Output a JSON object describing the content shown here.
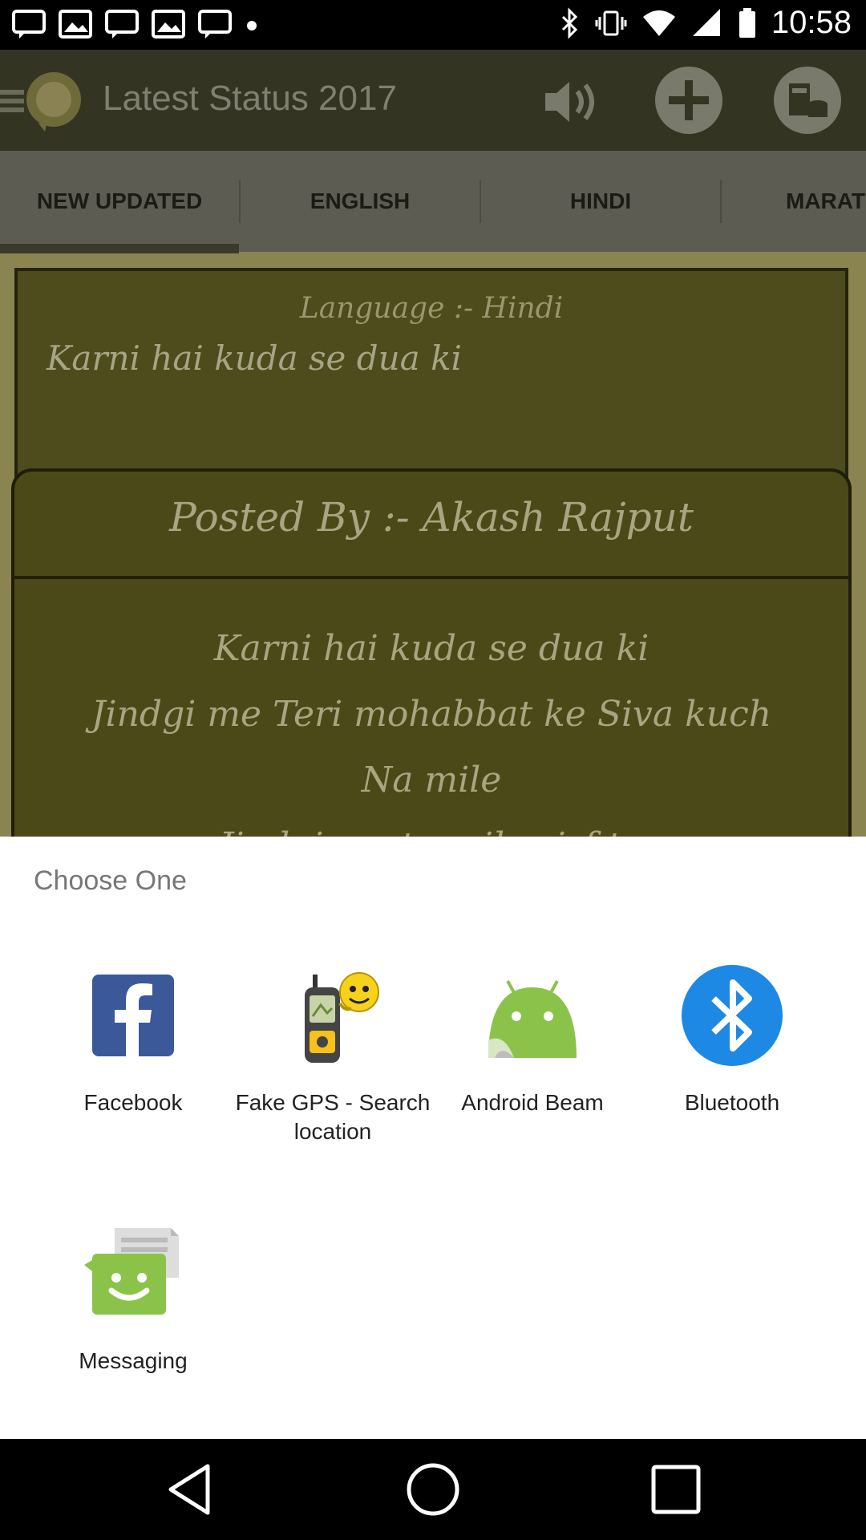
{
  "status_bar": {
    "time": "10:58",
    "left_icons": [
      "message-icon",
      "gallery-icon",
      "message-icon",
      "gallery-icon",
      "message-icon",
      "notification-dot-icon"
    ],
    "right_icons": [
      "bluetooth-icon",
      "vibrate-icon",
      "wifi-icon",
      "signal-icon",
      "battery-icon"
    ]
  },
  "app": {
    "title": "Latest Status 2017",
    "tabs": [
      "NEW UPDATED",
      "ENGLISH",
      "HINDI",
      "MARAT"
    ],
    "card": {
      "language": "Language :- Hindi",
      "snippet": "Karni hai kuda se dua ki",
      "posted_by": "Posted By :- Akash Rajput",
      "poem_lines": [
        "Karni hai kuda se dua ki",
        "Jindgi me Teri mohabbat ke Siva kuch",
        "Na mile",
        "Jindgi me tu mile sirf tu"
      ]
    }
  },
  "share_sheet": {
    "title": "Choose One",
    "apps": [
      {
        "label": "Facebook",
        "icon": "facebook-icon"
      },
      {
        "label": "Fake GPS - Search location",
        "icon": "gps-device-icon"
      },
      {
        "label": "Android Beam",
        "icon": "android-icon"
      },
      {
        "label": "Bluetooth",
        "icon": "bluetooth-icon"
      },
      {
        "label": "Messaging",
        "icon": "messaging-icon"
      }
    ]
  },
  "nav_bar": {
    "buttons": [
      "back-icon",
      "home-icon",
      "recents-icon"
    ]
  },
  "colors": {
    "facebook": "#3b5998",
    "android": "#8bc34a",
    "bluetooth": "#1e88e5",
    "messaging": "#8bc34a"
  }
}
